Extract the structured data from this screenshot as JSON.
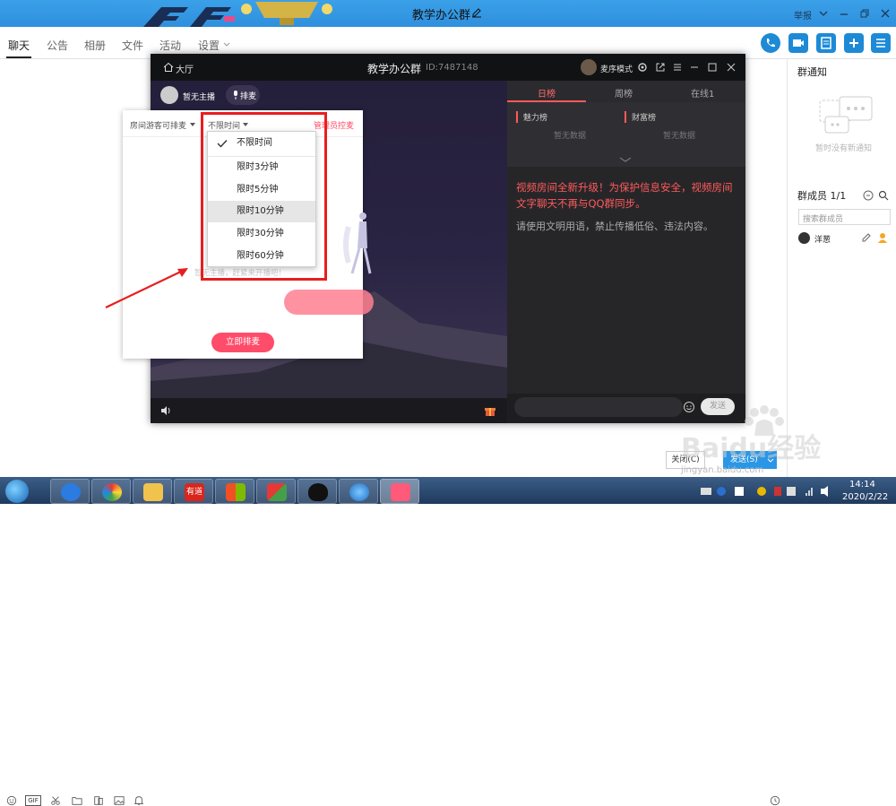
{
  "window": {
    "title": "教学办公群",
    "report": "举报"
  },
  "tabs": [
    {
      "label": "聊天"
    },
    {
      "label": "公告"
    },
    {
      "label": "相册"
    },
    {
      "label": "文件"
    },
    {
      "label": "活动"
    },
    {
      "label": "设置"
    }
  ],
  "right_pane": {
    "notice_title": "群通知",
    "notice_empty": "暂时没有新通知",
    "members_title": "群成员 1/1",
    "member_search_placeholder": "搜索群成员",
    "member_name": "洋葱"
  },
  "input": {
    "gif_label": "GIF",
    "close_label": "关闭(C)",
    "send_label": "发送(S)"
  },
  "video_room": {
    "hall": "大厅",
    "title": "教学办公群",
    "room_id": "ID:7487148",
    "mic_mode": "麦序模式",
    "host": "暂无主播",
    "queue": "排麦",
    "rank_tabs": [
      "日榜",
      "周榜",
      "在线1"
    ],
    "charm_rank": "魅力榜",
    "wealth_rank": "财富榜",
    "no_data": "暂无数据",
    "notice": "视频房间全新升级！为保护信息安全，视频房间文字聊天不再与QQ群同步。",
    "rules": "请使用文明用语，禁止传播低俗、违法内容。",
    "send": "发送"
  },
  "queue_popup": {
    "guest_option": "房间游客可排麦",
    "time_option": "不限时间",
    "admin_control": "管理员控麦",
    "empty_hint": "暂无主播，赶紧来开播吧！",
    "start_button": "立即排麦",
    "time_options": [
      "不限时间",
      "限时3分钟",
      "限时5分钟",
      "限时10分钟",
      "限时30分钟",
      "限时60分钟"
    ],
    "selected": "不限时间",
    "hovered": "限时10分钟"
  },
  "taskbar": {
    "youdao": "有道",
    "time": "14:14",
    "date": "2020/2/22"
  },
  "watermark": {
    "text": "Baidu经验",
    "url": "jingyan.baidu.com"
  },
  "colors": {
    "highlight": "#e81e1e",
    "accent_pink": "#ff4c6a",
    "qq_blue": "#2a96e6"
  }
}
